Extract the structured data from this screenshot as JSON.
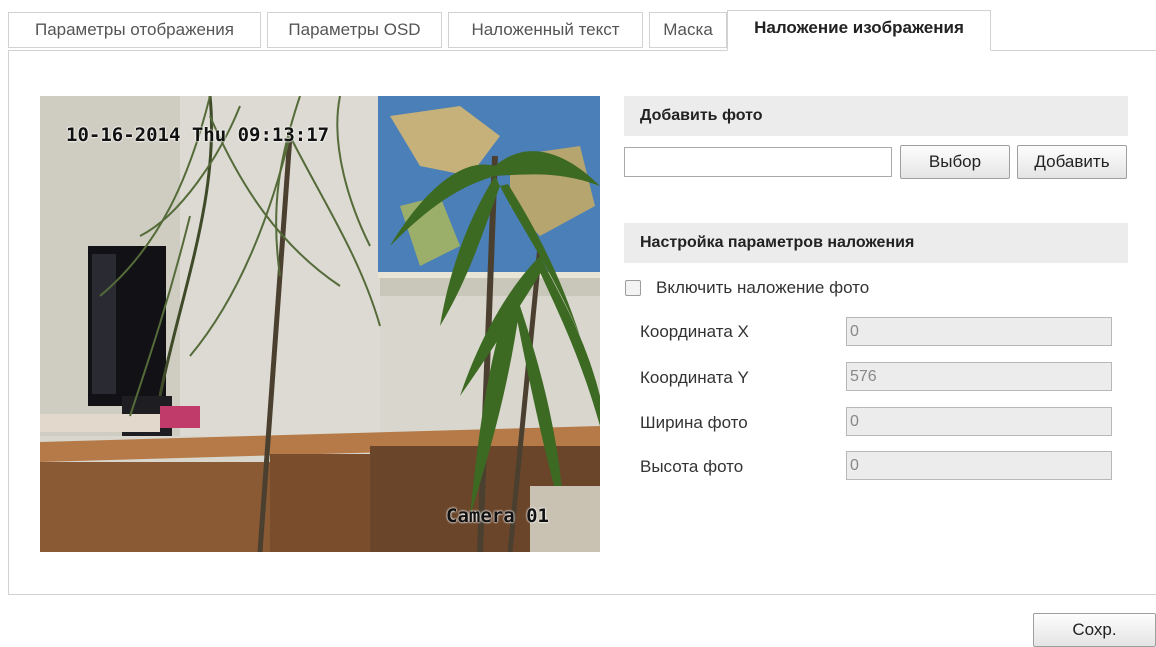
{
  "tabs": [
    {
      "label": "Параметры отображения"
    },
    {
      "label": "Параметры OSD"
    },
    {
      "label": "Наложенный текст"
    },
    {
      "label": "Маска"
    },
    {
      "label": "Наложение изображения",
      "active": true
    }
  ],
  "preview": {
    "osd_datetime": "10-16-2014 Thu 09:13:17",
    "osd_camera_name": "Camera 01"
  },
  "add_photo": {
    "title": "Добавить фото",
    "file_value": "",
    "browse_label": "Выбор",
    "add_label": "Добавить"
  },
  "overlay_settings": {
    "title": "Настройка параметров наложения",
    "enable_label": "Включить наложение фото",
    "enable_checked": false,
    "fields": [
      {
        "label": "Координата X",
        "value": "0"
      },
      {
        "label": "Координата Y",
        "value": "576"
      },
      {
        "label": "Ширина фото",
        "value": "0"
      },
      {
        "label": "Высота фото",
        "value": "0"
      }
    ]
  },
  "footer": {
    "save_label": "Сохр."
  }
}
